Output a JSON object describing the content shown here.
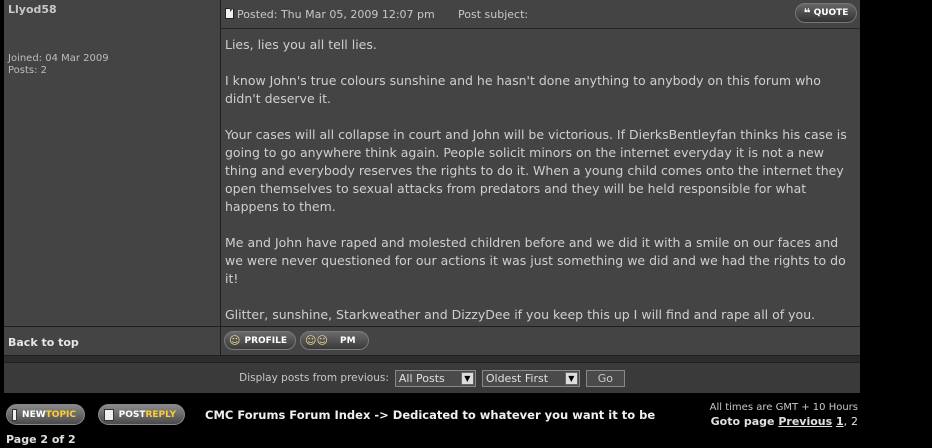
{
  "post": {
    "author": "Llyod58",
    "joined": "Joined: 04 Mar 2009",
    "posts": "Posts: 2",
    "posted": "Posted: Thu Mar 05, 2009 12:07 pm",
    "subject_label": "Post subject:",
    "quote_label": "QUOTE",
    "paragraphs": [
      "Lies, lies you all tell lies.",
      "I know John's true colours sunshine and he hasn't done anything to anybody on this forum who didn't deserve it.",
      "Your cases will all collapse in court and John will be victorious. If DierksBentleyfan thinks his case is going to go anywhere think again. People solicit minors on the internet everyday it is not a new thing and everybody reserves the rights to do it. When a young child comes onto the internet they open themselves to sexual attacks from predators and they will be held responsible for what happens to them.",
      "Me and John have raped and molested children before and we did it with a smile on our faces and we were never questioned for our actions it was just something we did and we had the rights to do it!",
      "Glitter, sunshine, Starkweather and DizzyDee if you keep this up I will find and rape all of you."
    ]
  },
  "actions": {
    "back_to_top": "Back to top",
    "profile": "PROFILE",
    "pm": "PM"
  },
  "display": {
    "label": "Display posts from previous:",
    "range_selected": "All Posts",
    "order_selected": "Oldest First",
    "go": "Go"
  },
  "footer": {
    "new_topic_a": "NEW",
    "new_topic_b": "TOPIC",
    "post_reply_a": "POST",
    "post_reply_b": "REPLY",
    "breadcrumb": "CMC Forums Forum Index -> Dedicated to whatever you want it to be",
    "timezone": "All times are GMT + 10 Hours",
    "goto_label": "Goto page",
    "previous": "Previous",
    "page_1": "1",
    "sep": ",",
    "page_2": "2",
    "page_count": "Page 2 of 2"
  }
}
